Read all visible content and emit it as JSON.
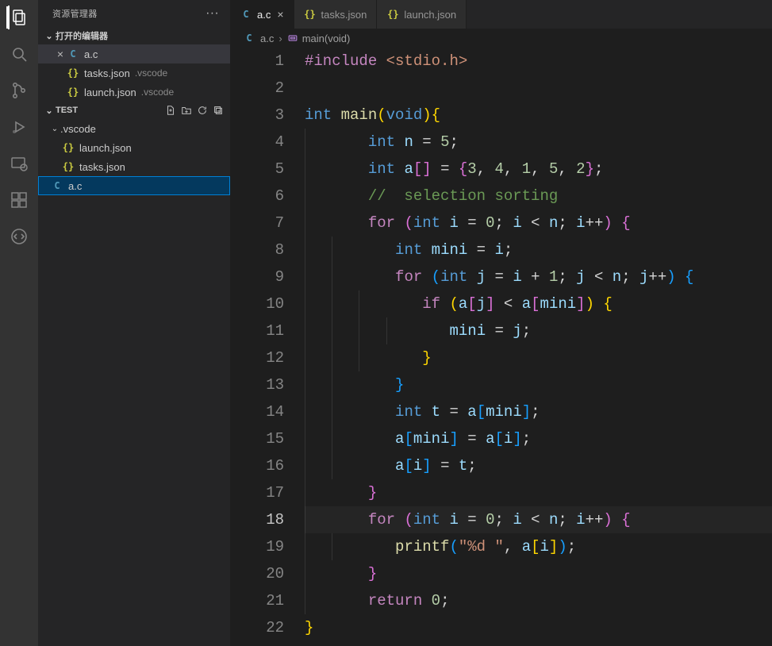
{
  "sidebar": {
    "title": "资源管理器",
    "openEditorsHeader": "打开的编辑器",
    "openEditors": [
      {
        "name": "a.c",
        "icon": "C",
        "active": true
      },
      {
        "name": "tasks.json",
        "icon": "{}",
        "dir": ".vscode"
      },
      {
        "name": "launch.json",
        "icon": "{}",
        "dir": ".vscode"
      }
    ],
    "projectHeader": "TEST",
    "tree": {
      "folder": ".vscode",
      "files": [
        {
          "name": "launch.json",
          "icon": "{}"
        },
        {
          "name": "tasks.json",
          "icon": "{}"
        }
      ],
      "rootFiles": [
        {
          "name": "a.c",
          "icon": "C",
          "selected": true
        }
      ]
    }
  },
  "tabs": [
    {
      "icon": "C",
      "label": "a.c",
      "active": true
    },
    {
      "icon": "{}",
      "label": "tasks.json"
    },
    {
      "icon": "{}",
      "label": "launch.json"
    }
  ],
  "breadcrumbs": {
    "file": "a.c",
    "fileIcon": "C",
    "symbol": "main(void)"
  },
  "currentLine": 18,
  "code": {
    "lines": [
      [
        {
          "c": "tok-pp",
          "t": "#include"
        },
        {
          "t": " "
        },
        {
          "c": "tok-inc",
          "t": "<stdio.h>"
        }
      ],
      [],
      [
        {
          "c": "tok-type",
          "t": "int"
        },
        {
          "t": " "
        },
        {
          "c": "tok-fn",
          "t": "main"
        },
        {
          "c": "tok-brc",
          "t": "("
        },
        {
          "c": "tok-type",
          "t": "void"
        },
        {
          "c": "tok-brc",
          "t": ")"
        },
        {
          "c": "tok-brc",
          "t": "{"
        }
      ],
      [
        {
          "g": 1
        },
        {
          "c": "tok-type",
          "t": "int"
        },
        {
          "t": " "
        },
        {
          "c": "tok-var",
          "t": "n"
        },
        {
          "t": " = "
        },
        {
          "c": "tok-num",
          "t": "5"
        },
        {
          "t": ";"
        }
      ],
      [
        {
          "g": 1
        },
        {
          "c": "tok-type",
          "t": "int"
        },
        {
          "t": " "
        },
        {
          "c": "tok-var",
          "t": "a"
        },
        {
          "c": "tok-brc2",
          "t": "["
        },
        {
          "c": "tok-brc2",
          "t": "]"
        },
        {
          "t": " = "
        },
        {
          "c": "tok-brc2",
          "t": "{"
        },
        {
          "c": "tok-num",
          "t": "3"
        },
        {
          "t": ", "
        },
        {
          "c": "tok-num",
          "t": "4"
        },
        {
          "t": ", "
        },
        {
          "c": "tok-num",
          "t": "1"
        },
        {
          "t": ", "
        },
        {
          "c": "tok-num",
          "t": "5"
        },
        {
          "t": ", "
        },
        {
          "c": "tok-num",
          "t": "2"
        },
        {
          "c": "tok-brc2",
          "t": "}"
        },
        {
          "t": ";"
        }
      ],
      [
        {
          "g": 1
        },
        {
          "c": "tok-com",
          "t": "//  selection sorting"
        }
      ],
      [
        {
          "g": 1
        },
        {
          "c": "tok-ctrl",
          "t": "for"
        },
        {
          "t": " "
        },
        {
          "c": "tok-brc2",
          "t": "("
        },
        {
          "c": "tok-type",
          "t": "int"
        },
        {
          "t": " "
        },
        {
          "c": "tok-var",
          "t": "i"
        },
        {
          "t": " = "
        },
        {
          "c": "tok-num",
          "t": "0"
        },
        {
          "t": "; "
        },
        {
          "c": "tok-var",
          "t": "i"
        },
        {
          "t": " < "
        },
        {
          "c": "tok-var",
          "t": "n"
        },
        {
          "t": "; "
        },
        {
          "c": "tok-var",
          "t": "i"
        },
        {
          "t": "++"
        },
        {
          "c": "tok-brc2",
          "t": ")"
        },
        {
          "t": " "
        },
        {
          "c": "tok-brc2",
          "t": "{"
        }
      ],
      [
        {
          "g": 2
        },
        {
          "c": "tok-type",
          "t": "int"
        },
        {
          "t": " "
        },
        {
          "c": "tok-var",
          "t": "mini"
        },
        {
          "t": " = "
        },
        {
          "c": "tok-var",
          "t": "i"
        },
        {
          "t": ";"
        }
      ],
      [
        {
          "g": 2
        },
        {
          "c": "tok-ctrl",
          "t": "for"
        },
        {
          "t": " "
        },
        {
          "c": "tok-brc3",
          "t": "("
        },
        {
          "c": "tok-type",
          "t": "int"
        },
        {
          "t": " "
        },
        {
          "c": "tok-var",
          "t": "j"
        },
        {
          "t": " = "
        },
        {
          "c": "tok-var",
          "t": "i"
        },
        {
          "t": " + "
        },
        {
          "c": "tok-num",
          "t": "1"
        },
        {
          "t": "; "
        },
        {
          "c": "tok-var",
          "t": "j"
        },
        {
          "t": " < "
        },
        {
          "c": "tok-var",
          "t": "n"
        },
        {
          "t": "; "
        },
        {
          "c": "tok-var",
          "t": "j"
        },
        {
          "t": "++"
        },
        {
          "c": "tok-brc3",
          "t": ")"
        },
        {
          "t": " "
        },
        {
          "c": "tok-brc3",
          "t": "{"
        }
      ],
      [
        {
          "g": 3
        },
        {
          "c": "tok-ctrl",
          "t": "if"
        },
        {
          "t": " "
        },
        {
          "c": "tok-brc",
          "t": "("
        },
        {
          "c": "tok-var",
          "t": "a"
        },
        {
          "c": "tok-brc2",
          "t": "["
        },
        {
          "c": "tok-var",
          "t": "j"
        },
        {
          "c": "tok-brc2",
          "t": "]"
        },
        {
          "t": " < "
        },
        {
          "c": "tok-var",
          "t": "a"
        },
        {
          "c": "tok-brc2",
          "t": "["
        },
        {
          "c": "tok-var",
          "t": "mini"
        },
        {
          "c": "tok-brc2",
          "t": "]"
        },
        {
          "c": "tok-brc",
          "t": ")"
        },
        {
          "t": " "
        },
        {
          "c": "tok-brc",
          "t": "{"
        }
      ],
      [
        {
          "g": 4
        },
        {
          "c": "tok-var",
          "t": "mini"
        },
        {
          "t": " = "
        },
        {
          "c": "tok-var",
          "t": "j"
        },
        {
          "t": ";"
        }
      ],
      [
        {
          "g": 3
        },
        {
          "c": "tok-brc",
          "t": "}"
        }
      ],
      [
        {
          "g": 2
        },
        {
          "c": "tok-brc3",
          "t": "}"
        }
      ],
      [
        {
          "g": 2
        },
        {
          "c": "tok-type",
          "t": "int"
        },
        {
          "t": " "
        },
        {
          "c": "tok-var",
          "t": "t"
        },
        {
          "t": " = "
        },
        {
          "c": "tok-var",
          "t": "a"
        },
        {
          "c": "tok-brc3",
          "t": "["
        },
        {
          "c": "tok-var",
          "t": "mini"
        },
        {
          "c": "tok-brc3",
          "t": "]"
        },
        {
          "t": ";"
        }
      ],
      [
        {
          "g": 2
        },
        {
          "c": "tok-var",
          "t": "a"
        },
        {
          "c": "tok-brc3",
          "t": "["
        },
        {
          "c": "tok-var",
          "t": "mini"
        },
        {
          "c": "tok-brc3",
          "t": "]"
        },
        {
          "t": " = "
        },
        {
          "c": "tok-var",
          "t": "a"
        },
        {
          "c": "tok-brc3",
          "t": "["
        },
        {
          "c": "tok-var",
          "t": "i"
        },
        {
          "c": "tok-brc3",
          "t": "]"
        },
        {
          "t": ";"
        }
      ],
      [
        {
          "g": 2
        },
        {
          "c": "tok-var",
          "t": "a"
        },
        {
          "c": "tok-brc3",
          "t": "["
        },
        {
          "c": "tok-var",
          "t": "i"
        },
        {
          "c": "tok-brc3",
          "t": "]"
        },
        {
          "t": " = "
        },
        {
          "c": "tok-var",
          "t": "t"
        },
        {
          "t": ";"
        }
      ],
      [
        {
          "g": 1
        },
        {
          "c": "tok-brc2",
          "t": "}"
        }
      ],
      [
        {
          "g": 1
        },
        {
          "c": "tok-ctrl",
          "t": "for"
        },
        {
          "t": " "
        },
        {
          "c": "tok-brc2",
          "t": "("
        },
        {
          "c": "tok-type",
          "t": "int"
        },
        {
          "t": " "
        },
        {
          "c": "tok-var",
          "t": "i"
        },
        {
          "t": " = "
        },
        {
          "c": "tok-num",
          "t": "0"
        },
        {
          "t": "; "
        },
        {
          "c": "tok-var",
          "t": "i"
        },
        {
          "t": " < "
        },
        {
          "c": "tok-var",
          "t": "n"
        },
        {
          "t": "; "
        },
        {
          "c": "tok-var",
          "t": "i"
        },
        {
          "t": "++"
        },
        {
          "c": "tok-brc2",
          "t": ")"
        },
        {
          "t": " "
        },
        {
          "c": "tok-brc2",
          "t": "{"
        }
      ],
      [
        {
          "g": 2
        },
        {
          "c": "tok-fn",
          "t": "printf"
        },
        {
          "c": "tok-brc3",
          "t": "("
        },
        {
          "c": "tok-str",
          "t": "\"%d \""
        },
        {
          "t": ", "
        },
        {
          "c": "tok-var",
          "t": "a"
        },
        {
          "c": "tok-brc",
          "t": "["
        },
        {
          "c": "tok-var",
          "t": "i"
        },
        {
          "c": "tok-brc",
          "t": "]"
        },
        {
          "c": "tok-brc3",
          "t": ")"
        },
        {
          "t": ";"
        }
      ],
      [
        {
          "g": 1
        },
        {
          "c": "tok-brc2",
          "t": "}"
        }
      ],
      [
        {
          "g": 1
        },
        {
          "c": "tok-ctrl",
          "t": "return"
        },
        {
          "t": " "
        },
        {
          "c": "tok-num",
          "t": "0"
        },
        {
          "t": ";"
        }
      ],
      [
        {
          "c": "tok-brc",
          "t": "}"
        }
      ]
    ]
  }
}
